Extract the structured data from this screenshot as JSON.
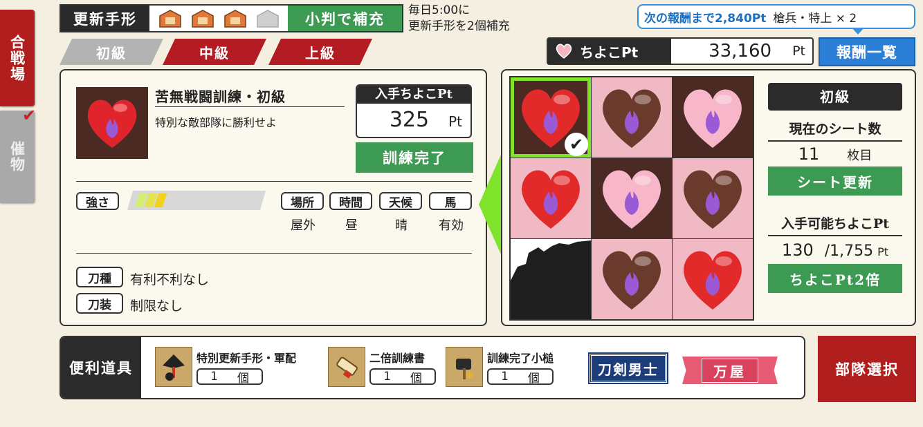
{
  "sidebar": {
    "tabs": [
      {
        "label": "合戦場",
        "active": true
      },
      {
        "label": "催物",
        "active": false
      }
    ]
  },
  "header": {
    "pass_label": "更新手形",
    "pass_tokens_filled": 3,
    "pass_tokens_total": 4,
    "refill_button": "小判で補充",
    "refill_note_line1": "毎日5:00に",
    "refill_note_line2": "更新手形を2個補充",
    "reward_highlight": "次の報酬まで2,840Pt",
    "reward_item": "槍兵・特上 × 2",
    "difficulty_tabs": [
      "初級",
      "中級",
      "上級"
    ],
    "choco_label": "ちよこPt",
    "choco_value": "33,160",
    "choco_unit": "Pt",
    "reward_list_button": "報酬一覧"
  },
  "mission": {
    "title": "苦無戦闘訓練・初級",
    "description": "特別な敵部隊に勝利せよ",
    "gain_label": "入手ちよこPt",
    "gain_value": "325",
    "gain_unit": "Pt",
    "done_button": "訓練完了",
    "strength_label": "強さ",
    "strength_level": 3,
    "strength_max": 10,
    "conditions": [
      {
        "label": "場所",
        "value": "屋外"
      },
      {
        "label": "時間",
        "value": "昼"
      },
      {
        "label": "天候",
        "value": "晴"
      },
      {
        "label": "馬",
        "value": "有効"
      }
    ],
    "sword_type_label": "刀種",
    "sword_type_value": "有利不利なし",
    "equipment_label": "刀装",
    "equipment_value": "制限なし"
  },
  "sheet": {
    "cells": [
      {
        "heart": "red",
        "bg": "brown",
        "selected": true,
        "cleared": true
      },
      {
        "heart": "brown",
        "bg": "pink",
        "selected": false,
        "cleared": false
      },
      {
        "heart": "pink",
        "bg": "brown",
        "selected": false,
        "cleared": false
      },
      {
        "heart": "red",
        "bg": "pink",
        "selected": false,
        "cleared": false
      },
      {
        "heart": "pink",
        "bg": "brown",
        "selected": false,
        "cleared": false
      },
      {
        "heart": "brown",
        "bg": "pink",
        "selected": false,
        "cleared": false
      },
      {
        "heart": "boss",
        "bg": "dark",
        "selected": false,
        "cleared": false
      },
      {
        "heart": "brown",
        "bg": "pink",
        "selected": false,
        "cleared": false
      },
      {
        "heart": "red",
        "bg": "pink",
        "selected": false,
        "cleared": false
      }
    ],
    "level_label": "初級",
    "count_label": "現在のシート数",
    "count_value": "11",
    "count_unit": "枚目",
    "refresh_button": "シート更新",
    "available_label": "入手可能ちよこPt",
    "available_current": "130",
    "available_total": "/1,755",
    "available_unit": "Pt",
    "double_button": "ちよこPt2倍"
  },
  "tools": {
    "label": "便利道具",
    "items": [
      {
        "name": "特別更新手形・軍配",
        "count": "1",
        "unit": "個"
      },
      {
        "name": "二倍訓練書",
        "count": "1",
        "unit": "個"
      },
      {
        "name": "訓練完了小槌",
        "count": "1",
        "unit": "個"
      }
    ],
    "touken_button": "刀剣男士",
    "yorozu_button": "万屋"
  },
  "unit_select_button": "部隊選択",
  "colors": {
    "red": "#b01e1e",
    "green": "#3c9a52",
    "blue": "#2b7fd6",
    "lime": "#7fe32b",
    "dark": "#2b2b2b",
    "pink_cell": "#f0b9c4",
    "brown_cell": "#4a2a23"
  }
}
